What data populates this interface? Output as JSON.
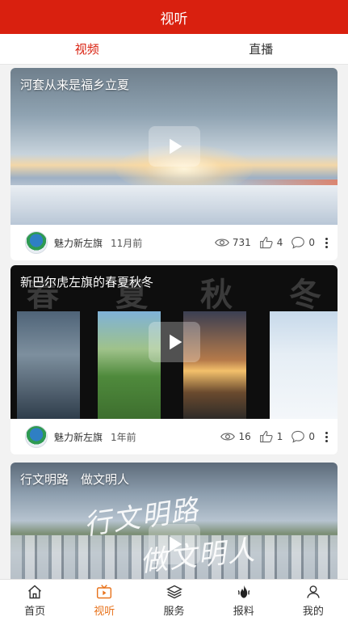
{
  "header": {
    "title": "视听"
  },
  "tabs": [
    {
      "label": "视频",
      "active": true
    },
    {
      "label": "直播",
      "active": false
    }
  ],
  "feed": [
    {
      "title": "河套从来是福乡立夏",
      "source": "魅力新左旗",
      "age": "11月前",
      "views": "731",
      "likes": "4",
      "comments": "0"
    },
    {
      "title": "新巴尔虎左旗的春夏秋冬",
      "source": "魅力新左旗",
      "age": "1年前",
      "likes": "16",
      "comments_mid": "1",
      "comments": "0",
      "season_chars": [
        "春",
        "夏",
        "秋",
        "冬"
      ]
    },
    {
      "title": "行文明路　做文明人",
      "calligraphy_1": "行文明路",
      "calligraphy_2": "做文明人"
    }
  ],
  "tabbar": [
    {
      "label": "首页",
      "icon": "home-icon"
    },
    {
      "label": "视听",
      "icon": "tv-icon",
      "active": true
    },
    {
      "label": "服务",
      "icon": "layers-icon"
    },
    {
      "label": "报料",
      "icon": "fire-icon"
    },
    {
      "label": "我的",
      "icon": "user-icon"
    }
  ],
  "colors": {
    "brand_red": "#d9200f",
    "active_tab_orange": "#e8731c"
  }
}
